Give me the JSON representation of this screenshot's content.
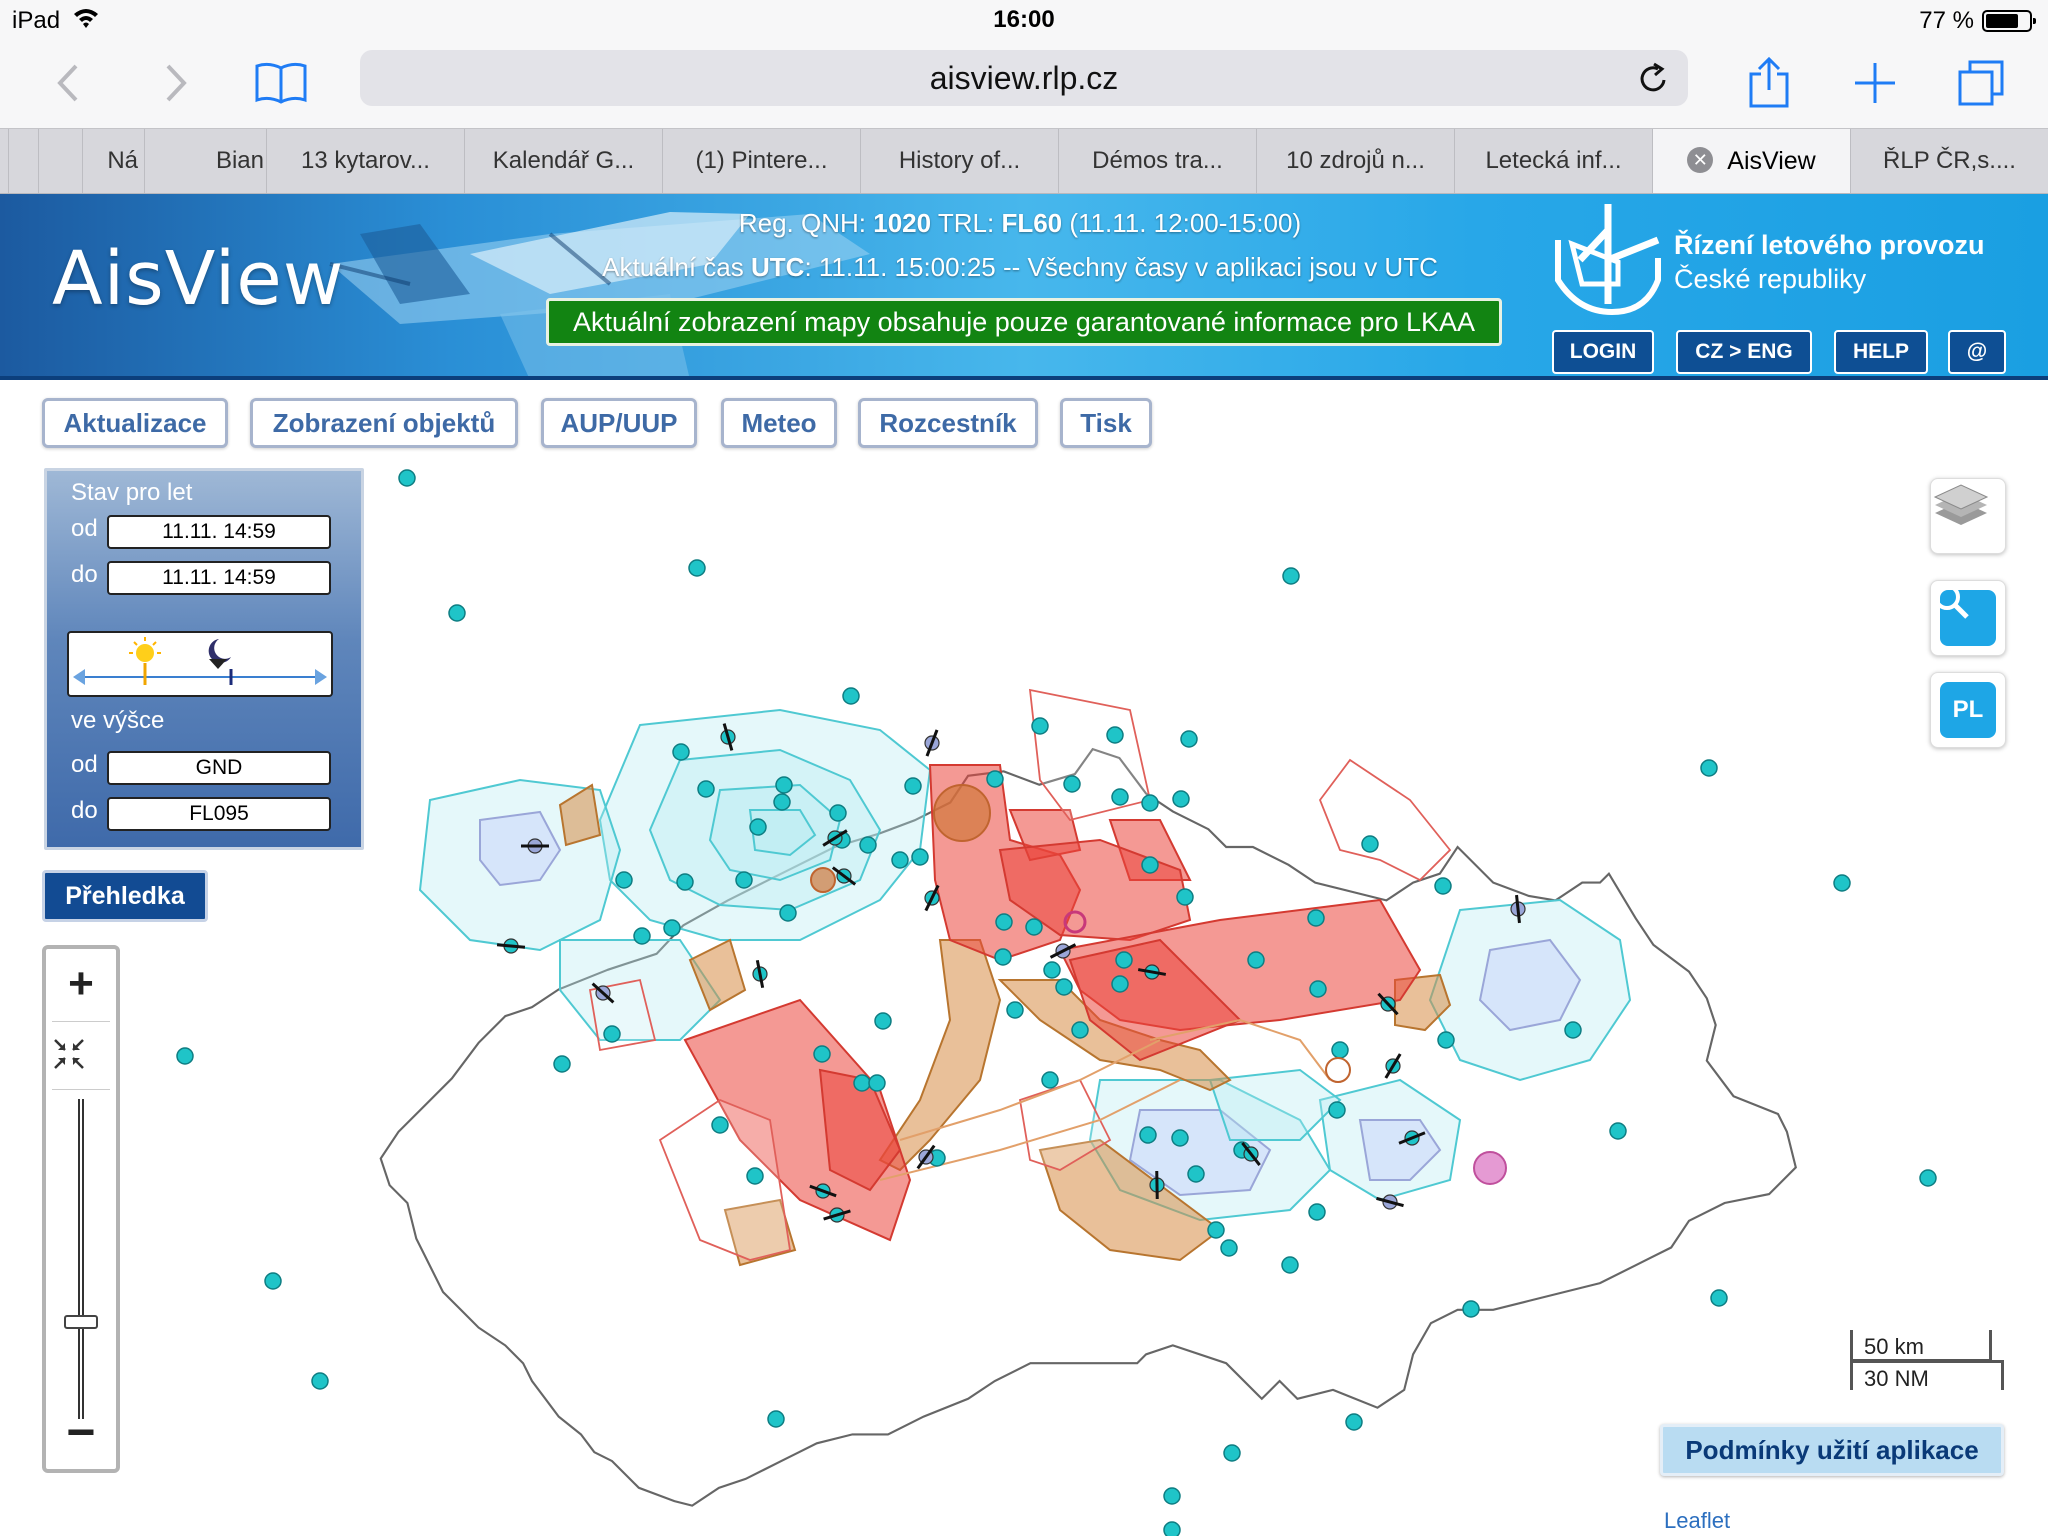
{
  "status_bar": {
    "device": "iPad",
    "time": "16:00",
    "battery": "77 %",
    "battery_level": 0.77
  },
  "browser": {
    "url": "aisview.rlp.cz",
    "tabs": [
      {
        "label": "Ná"
      },
      {
        "label": "Bian"
      },
      {
        "label": "13 kytarov..."
      },
      {
        "label": "Kalendář G..."
      },
      {
        "label": "(1) Pintere..."
      },
      {
        "label": "History of..."
      },
      {
        "label": "Démos tra..."
      },
      {
        "label": "10 zdrojů n..."
      },
      {
        "label": "Letecká inf..."
      },
      {
        "label": "AisView",
        "active": true
      },
      {
        "label": "ŘLP ČR,s...."
      }
    ]
  },
  "header": {
    "logo": "AisView",
    "qnh_label": "Reg. QNH:",
    "qnh_value": "1020",
    "trl_label": "TRL:",
    "trl_value": "FL60",
    "trl_period": "(11.11. 12:00-15:00)",
    "time_prefix": "Aktuální čas",
    "time_utc": "UTC",
    "time_value": ": 11.11. 15:00:25 -- Všechny časy v aplikaci jsou v UTC",
    "notice": "Aktuální zobrazení mapy obsahuje pouze garantované informace pro LKAA",
    "org_line1": "Řízení letového provozu",
    "org_line2": "České republiky",
    "buttons": {
      "login": "LOGIN",
      "lang": "CZ > ENG",
      "help": "HELP",
      "contact": "@"
    }
  },
  "menu": [
    "Aktualizace",
    "Zobrazení objektů",
    "AUP/UUP",
    "Meteo",
    "Rozcestník",
    "Tisk"
  ],
  "flight_state": {
    "title": "Stav pro let",
    "from_label": "od",
    "from_value": "11.11. 14:59",
    "to_label": "do",
    "to_value": "11.11. 14:59",
    "altitude_title": "ve výšce",
    "alt_from_label": "od",
    "alt_from_value": "GND",
    "alt_to_label": "do",
    "alt_to_value": "FL095"
  },
  "overview_button": "Přehledka",
  "zoom": {
    "in": "+",
    "out": "−",
    "level": 0.3
  },
  "side_controls": {
    "layers": "layers-icon",
    "search": "search-icon",
    "pl": "PL"
  },
  "scale": {
    "metric": "50 km",
    "nautical": "30 NM"
  },
  "terms_button": "Podmínky užití aplikace",
  "attribution": "Leaflet",
  "colors": {
    "banner_blue": "#2a8fd6",
    "notice_green": "#128412",
    "airspace_red": "#e8443c",
    "airspace_cyan": "#4fc9d2",
    "marker_teal": "#1fc4c8"
  }
}
